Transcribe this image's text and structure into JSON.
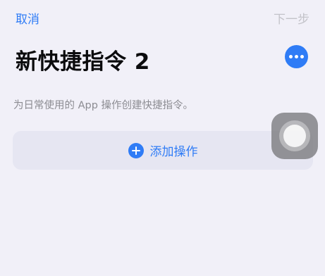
{
  "nav": {
    "cancel_label": "取消",
    "next_label": "下一步"
  },
  "shortcut": {
    "title": "新快捷指令 2",
    "description": "为日常使用的 App 操作创建快捷指令。"
  },
  "actions": {
    "add_label": "添加操作"
  },
  "colors": {
    "accent": "#2f7cf6",
    "background": "#f1f0f8",
    "disabled_text": "#c3c3c9",
    "secondary_text": "#8c8c92"
  },
  "icons": {
    "more": "ellipsis-circle",
    "add": "plus-circle",
    "assistive_touch": "assistive-touch"
  }
}
